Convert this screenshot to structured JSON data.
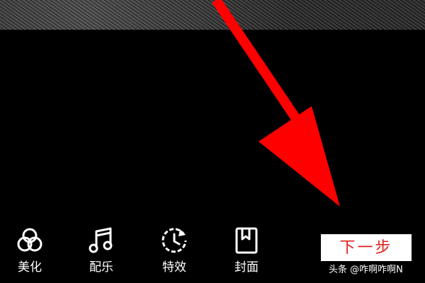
{
  "toolbar": {
    "items": [
      {
        "label": "美化",
        "icon": "three-circles-icon"
      },
      {
        "label": "配乐",
        "icon": "music-note-icon"
      },
      {
        "label": "特效",
        "icon": "clock-refresh-icon"
      },
      {
        "label": "封面",
        "icon": "bookmark-frame-icon"
      }
    ]
  },
  "next_button": {
    "label": "下一步"
  },
  "watermark": {
    "text": "头条 @咋啊咋啊N"
  },
  "colors": {
    "background": "#000000",
    "arrow": "#ff0000",
    "next_text": "#e0201b"
  }
}
